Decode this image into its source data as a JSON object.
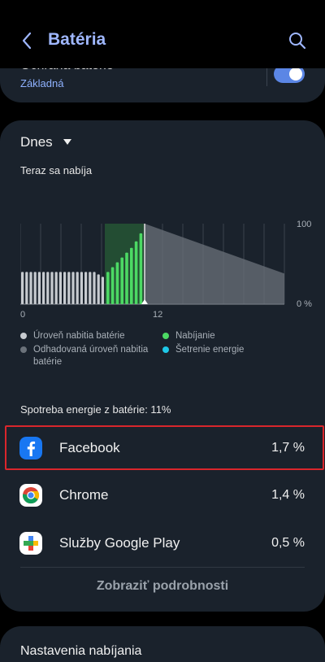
{
  "header": {
    "title": "Batéria",
    "back_icon": "back-arrow-icon",
    "search_icon": "search-icon"
  },
  "protection": {
    "title": "Ochrana batérie",
    "value": "Základná",
    "toggle_on": true
  },
  "usage_card": {
    "period": "Dnes",
    "status": "Teraz sa nabíja",
    "usage_total": "Spotreba energie z batérie: 11%",
    "details_link": "Zobraziť podrobnosti"
  },
  "chart_data": {
    "type": "bar",
    "x_tick_labels": [
      "0",
      "12"
    ],
    "y_tick_labels": [
      "100",
      "0 %"
    ],
    "ylim": [
      0,
      100
    ],
    "level_bars": [
      40,
      40,
      40,
      40,
      40,
      40,
      40,
      40,
      40,
      40,
      40,
      40,
      40,
      40,
      40,
      40,
      40,
      40,
      37,
      34
    ],
    "charging_bars": [
      40,
      46,
      52,
      58,
      64,
      70,
      78,
      88
    ],
    "projected_start": 100,
    "projected_end": 38
  },
  "legend": {
    "items": [
      {
        "label": "Úroveň nabitia batérie",
        "color": "#c7cbd0"
      },
      {
        "label": "Nabíjanie",
        "color": "#4cd964"
      },
      {
        "label": "Odhadovaná úroveň nabitia batérie",
        "color": "#6b727a"
      },
      {
        "label": "Šetrenie energie",
        "color": "#1ec8e8"
      }
    ]
  },
  "apps": [
    {
      "name": "Facebook",
      "percent": "1,7 %",
      "icon": "facebook-icon"
    },
    {
      "name": "Chrome",
      "percent": "1,4 %",
      "icon": "chrome-icon"
    },
    {
      "name": "Služby Google Play",
      "percent": "0,5 %",
      "icon": "google-play-services-icon"
    }
  ],
  "charging_settings": {
    "label": "Nastavenia nabíjania"
  },
  "colors": {
    "accent": "#9fb7ff",
    "card": "#1a222c",
    "highlight": "#d9262c"
  }
}
